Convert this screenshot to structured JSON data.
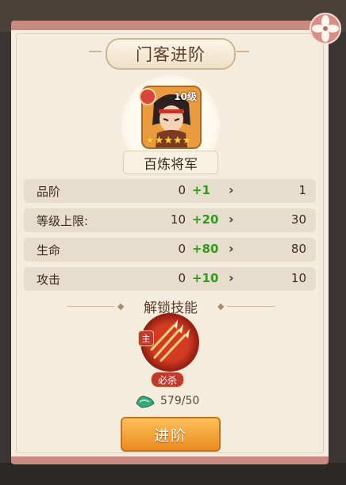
{
  "dialog": {
    "title": "门客进阶",
    "close_icon": "flower-close-icon"
  },
  "hero": {
    "name": "百炼将军",
    "level": "10级",
    "stars": 5,
    "faction_icon": "faction-badge-icon"
  },
  "stats": [
    {
      "label": "品阶",
      "from": "0",
      "plus": "+1",
      "to": "1"
    },
    {
      "label": "等级上限:",
      "from": "10",
      "plus": "+20",
      "to": "30"
    },
    {
      "label": "生命",
      "from": "0",
      "plus": "+80",
      "to": "80"
    },
    {
      "label": "攻击",
      "from": "0",
      "plus": "+10",
      "to": "10"
    }
  ],
  "unlock": {
    "title": "解锁技能",
    "skill_tag_main": "主",
    "skill_tag_kill": "必杀",
    "skill_icon": "triple-spear-icon"
  },
  "cost": {
    "icon": "green-jade-icon",
    "text": "579/50"
  },
  "advance_button": "进阶",
  "colors": {
    "panel": "#f4ecdd",
    "border": "#c98a82",
    "plus_green": "#2f9a1e",
    "button_orange": "#e98b1f"
  }
}
